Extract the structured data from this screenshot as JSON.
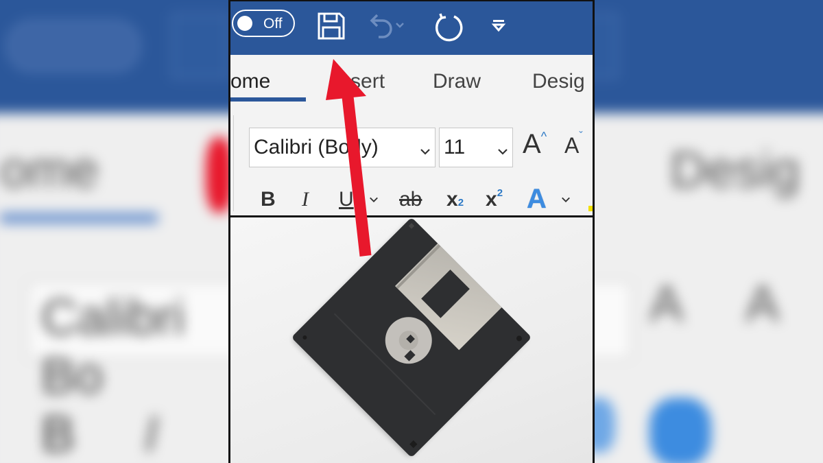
{
  "quick_access": {
    "autosave_label": "Off",
    "save_icon": "save-icon",
    "undo_icon": "undo-icon",
    "redo_icon": "redo-icon",
    "customize_icon": "customize-qat-icon"
  },
  "tabs": [
    {
      "label": "ome",
      "active": true
    },
    {
      "label": "Insert",
      "active": false
    },
    {
      "label": "Draw",
      "active": false
    },
    {
      "label": "Desig",
      "active": false
    }
  ],
  "font": {
    "family": "Calibri (Body)",
    "size": "11"
  },
  "format_buttons": {
    "bold": "B",
    "italic": "I",
    "underline": "U",
    "strikethrough": "ab",
    "subscript": "x",
    "subscript_mark": "2",
    "superscript": "x",
    "superscript_mark": "2",
    "text_effects": "A"
  },
  "size_buttons": {
    "grow": "A",
    "shrink": "A"
  },
  "backdrop": {
    "left_tab": "ome",
    "left_font": "Calibri Bo",
    "right_tab": "Desig"
  },
  "colors": {
    "ribbon_blue": "#2b579a",
    "arrow_red": "#e8182c",
    "ribbon_gray": "#f3f3f3"
  }
}
